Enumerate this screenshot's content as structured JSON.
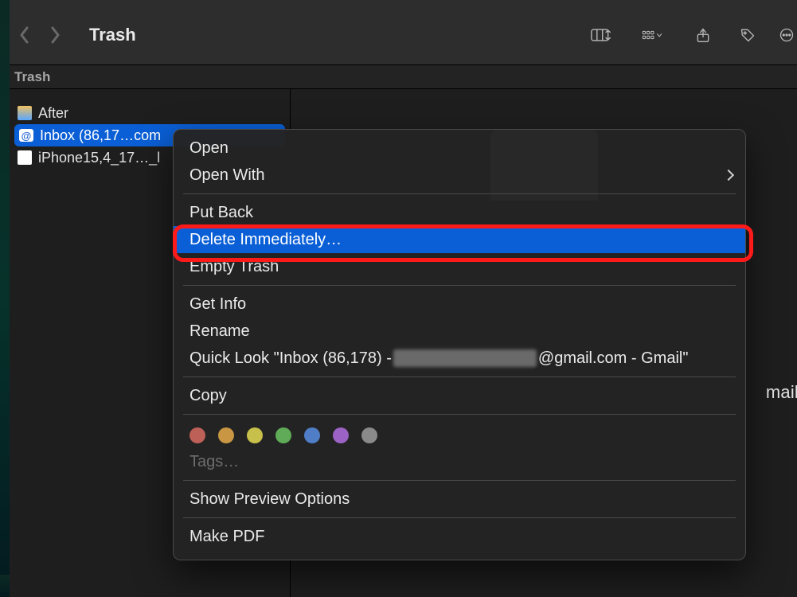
{
  "toolbar": {
    "title": "Trash"
  },
  "pathbar": {
    "label": "Trash"
  },
  "files": {
    "after": "After",
    "inbox": "Inbox (86,17…com",
    "iphone": "iPhone15,4_17…_l"
  },
  "preview": {
    "suffix": "mail"
  },
  "ctx": {
    "open": "Open",
    "open_with": "Open With",
    "put_back": "Put Back",
    "delete_immediately": "Delete Immediately…",
    "empty_trash": "Empty Trash",
    "get_info": "Get Info",
    "rename": "Rename",
    "quick_look_pre": "Quick Look \"Inbox (86,178) - ",
    "quick_look_post": "@gmail.com - Gmail\"",
    "copy": "Copy",
    "tags": "Tags…",
    "show_preview": "Show Preview Options",
    "make_pdf": "Make PDF"
  },
  "colors": {
    "red": "#bd6058",
    "orange": "#c99644",
    "yellow": "#c7c04a",
    "green": "#5fab57",
    "blue": "#4f7ec7",
    "purple": "#9c62c5",
    "gray": "#8a8a8a"
  }
}
